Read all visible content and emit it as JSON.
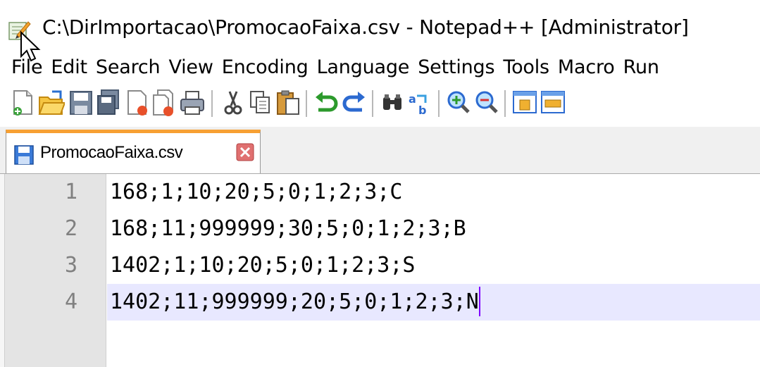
{
  "window": {
    "title": "C:\\DirImportacao\\PromocaoFaixa.csv - Notepad++ [Administrator]",
    "icon": "notepadpp-icon"
  },
  "menu": [
    "File",
    "Edit",
    "Search",
    "View",
    "Encoding",
    "Language",
    "Settings",
    "Tools",
    "Macro",
    "Run"
  ],
  "toolbar": {
    "buttons": [
      "new-file-icon",
      "open-file-icon",
      "save-icon",
      "save-all-icon",
      "close-icon",
      "close-all-icon",
      "print-icon",
      "cut-icon",
      "copy-icon",
      "paste-icon",
      "undo-icon",
      "redo-icon",
      "find-icon",
      "replace-icon",
      "zoom-in-icon",
      "zoom-out-icon",
      "sync-vertical-icon",
      "sync-horizontal-icon"
    ]
  },
  "tab": {
    "label": "PromocaoFaixa.csv",
    "accent": "#f7a033"
  },
  "editor": {
    "lines": [
      {
        "number": "1",
        "text": "168;1;10;20;5;0;1;2;3;C"
      },
      {
        "number": "2",
        "text": "168;11;999999;30;5;0;1;2;3;B"
      },
      {
        "number": "3",
        "text": "1402;1;10;20;5;0;1;2;3;S"
      },
      {
        "number": "4",
        "text": "1402;11;999999;20;5;0;1;2;3;N"
      }
    ],
    "current_line_color": "#e8e8ff",
    "caret_color": "#8000ff"
  }
}
